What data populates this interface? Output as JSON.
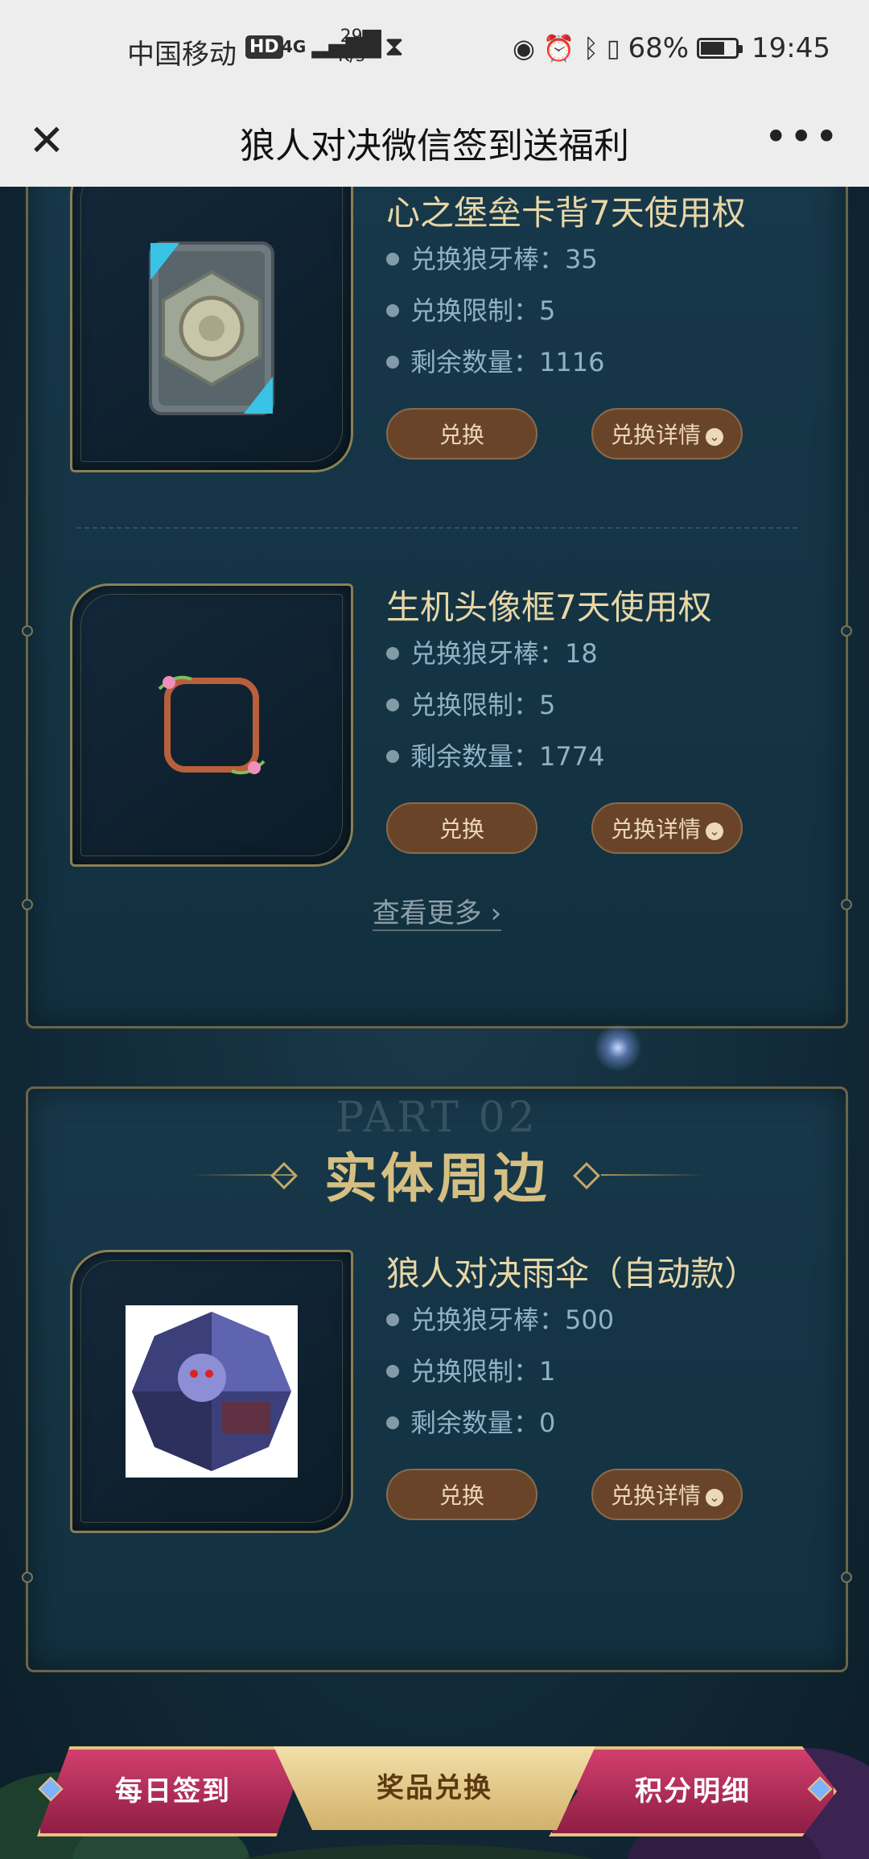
{
  "status_bar": {
    "carrier": "中国移动",
    "hd": "HD",
    "network": "4G",
    "speed_value": "29",
    "speed_unit": "K/s",
    "battery": "68%",
    "battery_level": 0.68,
    "time": "19:45"
  },
  "title_bar": {
    "close": "✕",
    "title": "狼人对决微信签到送福利",
    "more": "•••"
  },
  "virtual_items": [
    {
      "name": "心之堡垒卡背7天使用权",
      "cost": "兑换狼牙棒：35",
      "limit": "兑换限制：5",
      "remaining": "剩余数量：1116",
      "exchange": "兑换",
      "details": "兑换详情"
    },
    {
      "name": "生机头像框7天使用权",
      "cost": "兑换狼牙棒：18",
      "limit": "兑换限制：5",
      "remaining": "剩余数量：1774",
      "exchange": "兑换",
      "details": "兑换详情"
    }
  ],
  "see_more": "查看更多 ›",
  "physical_section": {
    "part": "PART 02",
    "title": "实体周边"
  },
  "physical_items": [
    {
      "name": "狼人对决雨伞（自动款）",
      "cost": "兑换狼牙棒：500",
      "limit": "兑换限制：1",
      "remaining": "剩余数量：0",
      "exchange": "兑换",
      "details": "兑换详情"
    }
  ],
  "bottom_nav": {
    "daily_checkin": "每日签到",
    "prize_exchange": "奖品兑换",
    "points_detail": "积分明细"
  },
  "colors": {
    "accent_gold": "#d6bf82",
    "button_brown": "#6a4429",
    "tab_pink": "#d23f6e"
  }
}
